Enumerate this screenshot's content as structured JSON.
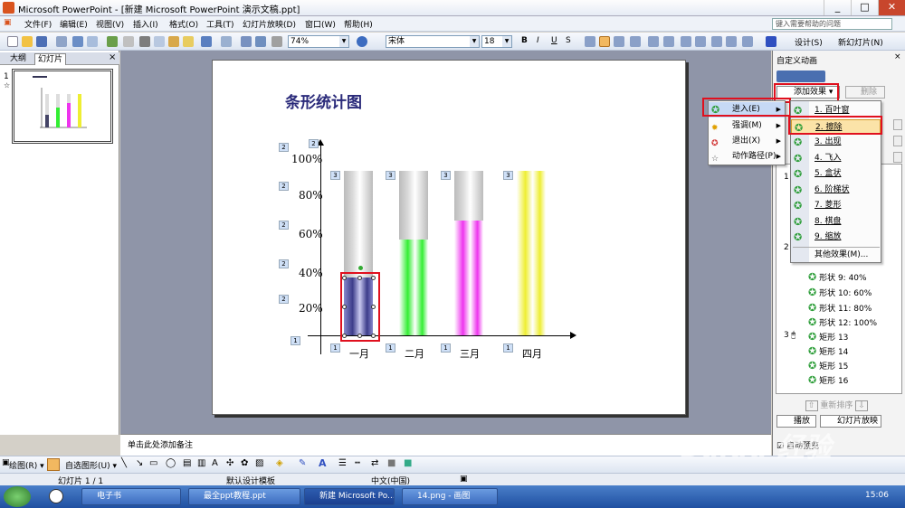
{
  "window": {
    "title": "Microsoft PowerPoint - [新建 Microsoft PowerPoint 演示文稿.ppt]",
    "minimize": "_",
    "maximize": "□",
    "close": "✕"
  },
  "menu": {
    "items": [
      "文件(F)",
      "编辑(E)",
      "视图(V)",
      "插入(I)",
      "格式(O)",
      "工具(T)",
      "幻灯片放映(D)",
      "窗口(W)",
      "帮助(H)"
    ],
    "help_placeholder": "键入需要帮助的问题"
  },
  "toolbar": {
    "zoom": "74%",
    "font": "宋体",
    "font_size": "18",
    "bold": "B",
    "italic": "I",
    "underline": "U",
    "shadow": "S",
    "design_label": "设计(S)",
    "new_slide_label": "新幻灯片(N)"
  },
  "left_pane": {
    "tabs": [
      "大纲",
      "幻灯片"
    ],
    "slide_number": "1",
    "slide_marker": "☆",
    "close": "×"
  },
  "slide": {
    "title": "条形统计图",
    "notes_placeholder": "单击此处添加备注"
  },
  "chart_data": {
    "type": "bar",
    "categories": [
      "一月",
      "二月",
      "三月",
      "四月"
    ],
    "values": [
      35,
      58,
      70,
      100
    ],
    "ylim": [
      0,
      100
    ],
    "yticks": [
      "20%",
      "40%",
      "60%",
      "80%",
      "100%"
    ],
    "bar_colors": [
      "#3c3c8a",
      "#33ee33",
      "#ee33ee",
      "#eeee33"
    ],
    "background_color": "#d9d9d9",
    "labels": {
      "y_axis": "2",
      "ticks": [
        "2",
        "2",
        "2",
        "2",
        "2"
      ],
      "bars": [
        "3",
        "3",
        "3",
        "3"
      ],
      "categories": [
        "1",
        "1",
        "1",
        "1"
      ],
      "x_axis": "1"
    }
  },
  "task_pane": {
    "title": "自定义动画",
    "add_effect": "添加效果 ▾",
    "remove": "删除",
    "list_numbers": [
      "1",
      "2",
      "3"
    ],
    "items": [
      "形状 9: 40%",
      "形状 10: 60%",
      "形状 11: 80%",
      "形状 12: 100%",
      "矩形 13",
      "矩形 14",
      "矩形 15",
      "矩形 16"
    ],
    "reorder": "重新排序",
    "play": "播放",
    "slideshow": "幻灯片放映",
    "autopreview": "自动预览"
  },
  "effect_menu": {
    "items": [
      "进入(E)",
      "强调(M)",
      "退出(X)",
      "动作路径(P)"
    ]
  },
  "entrance_submenu": {
    "items": [
      "1. 百叶窗",
      "2. 擦除",
      "3. 出现",
      "4. 飞入",
      "5. 盒状",
      "6. 阶梯状",
      "7. 菱形",
      "8. 棋盘",
      "9. 缩放"
    ],
    "more": "其他效果(M)..."
  },
  "drawing_toolbar": {
    "draw": "绘图(R) ▾",
    "autoshape": "自选图形(U) ▾"
  },
  "status": {
    "slide": "幻灯片 1 / 1",
    "template": "默认设计模板",
    "language": "中文(中国)"
  },
  "taskbar": {
    "buttons": [
      "电子书",
      "最全ppt教程.ppt",
      "新建 Microsoft Po...",
      "14.png - 画图"
    ],
    "clock": "15:06"
  },
  "watermark": "Baidu 经验"
}
